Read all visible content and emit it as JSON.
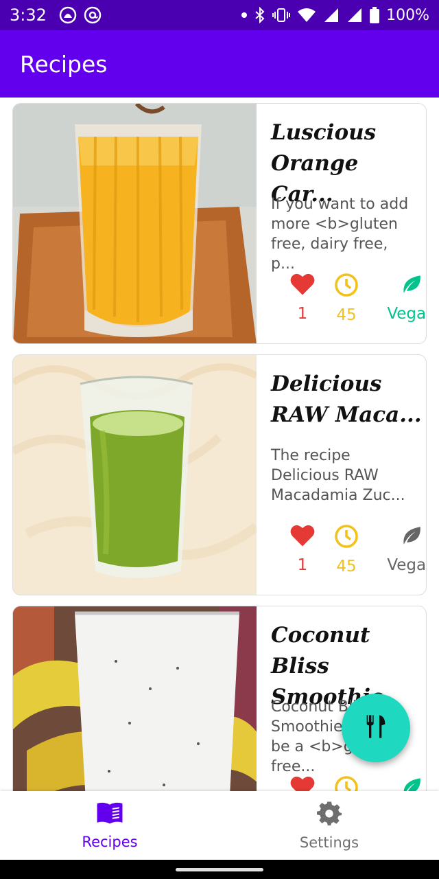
{
  "status_bar": {
    "time": "3:32",
    "battery": "100%",
    "icons": [
      "app-notification-icon",
      "at-sign-icon",
      "dot-icon",
      "bluetooth-icon",
      "vibrate-icon",
      "wifi-icon",
      "signal-icon",
      "signal-icon",
      "battery-icon"
    ]
  },
  "app_bar": {
    "title": "Recipes"
  },
  "recipes": [
    {
      "title": "Luscious Orange Car...",
      "description": "If you want to add more <b>gluten free, dairy free, p...",
      "likes": "1",
      "minutes": "45",
      "vegan_label": "Vegan",
      "vegan": true,
      "image": "orange-smoothie-photo"
    },
    {
      "title": "Delicious RAW Maca...",
      "description": "The recipe Delicious RAW Macadamia Zuc...",
      "likes": "1",
      "minutes": "45",
      "vegan_label": "Vegan",
      "vegan": false,
      "image": "green-smoothie-photo"
    },
    {
      "title": "Coconut Bliss Smoothie",
      "description": "Coconut Bliss Smoothie might be a <b>gluten free...",
      "likes": "",
      "minutes": "",
      "vegan_label": "",
      "vegan": true,
      "image": "coconut-banana-smoothie-photo"
    }
  ],
  "fab": {
    "icon": "fork-knife-icon"
  },
  "bottom_nav": {
    "items": [
      {
        "label": "Recipes",
        "icon": "book-icon",
        "active": true
      },
      {
        "label": "Settings",
        "icon": "gear-icon",
        "active": false
      }
    ]
  },
  "colors": {
    "primary": "#6200ee",
    "status_bar": "#4a00b0",
    "accent_fab": "#1ed8c0",
    "like_red": "#e53935",
    "time_amber": "#f2c21b",
    "vegan_green": "#00c48c",
    "inactive_grey": "#666666"
  }
}
